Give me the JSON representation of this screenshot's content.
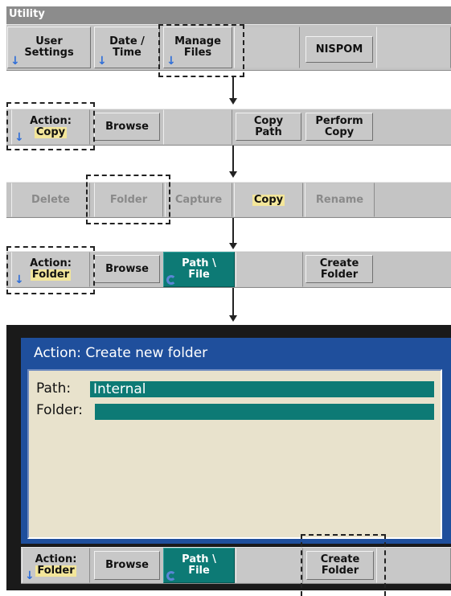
{
  "utility_menu": {
    "title": "Utility",
    "keys": [
      {
        "line1": "User",
        "line2": "Settings"
      },
      {
        "line1": "Date /",
        "line2": "Time"
      },
      {
        "line1": "Manage",
        "line2": "Files"
      },
      {
        "line1": "",
        "line2": ""
      },
      {
        "line1": "NISPOM",
        "line2": ""
      },
      {
        "line1": "",
        "line2": ""
      }
    ]
  },
  "manage_files_menu": {
    "action_label": "Action:",
    "action_value": "Copy",
    "browse": "Browse",
    "copy_path": {
      "line1": "Copy",
      "line2": "Path"
    },
    "perform_copy": {
      "line1": "Perform",
      "line2": "Copy"
    }
  },
  "action_choices": {
    "items": [
      "Delete",
      "Folder",
      "Capture",
      "Copy",
      "Rename"
    ],
    "selected": "Copy"
  },
  "folder_menu": {
    "action_label": "Action:",
    "action_value": "Folder",
    "browse": "Browse",
    "path_file": {
      "line1": "Path \\",
      "line2": "File"
    },
    "create_folder": {
      "line1": "Create",
      "line2": "Folder"
    }
  },
  "dialog": {
    "title": "Action: Create new folder",
    "path_label": "Path:",
    "path_value": "Internal",
    "folder_label": "Folder:",
    "folder_value": ""
  },
  "bottom_softkeys": {
    "action_label": "Action:",
    "action_value": "Folder",
    "browse": "Browse",
    "path_file": {
      "line1": "Path \\",
      "line2": "File"
    },
    "create_folder": {
      "line1": "Create",
      "line2": "Folder"
    }
  },
  "colors": {
    "teal": "#0d7a75",
    "screen_blue": "#1f4f9c",
    "panel_beige": "#e8e2cc",
    "softkey_gray": "#c8c8c8",
    "highlight": "#f3e69a"
  },
  "icons": [
    "down-arrow-icon",
    "cycle-icon",
    "connector-arrow-icon"
  ]
}
